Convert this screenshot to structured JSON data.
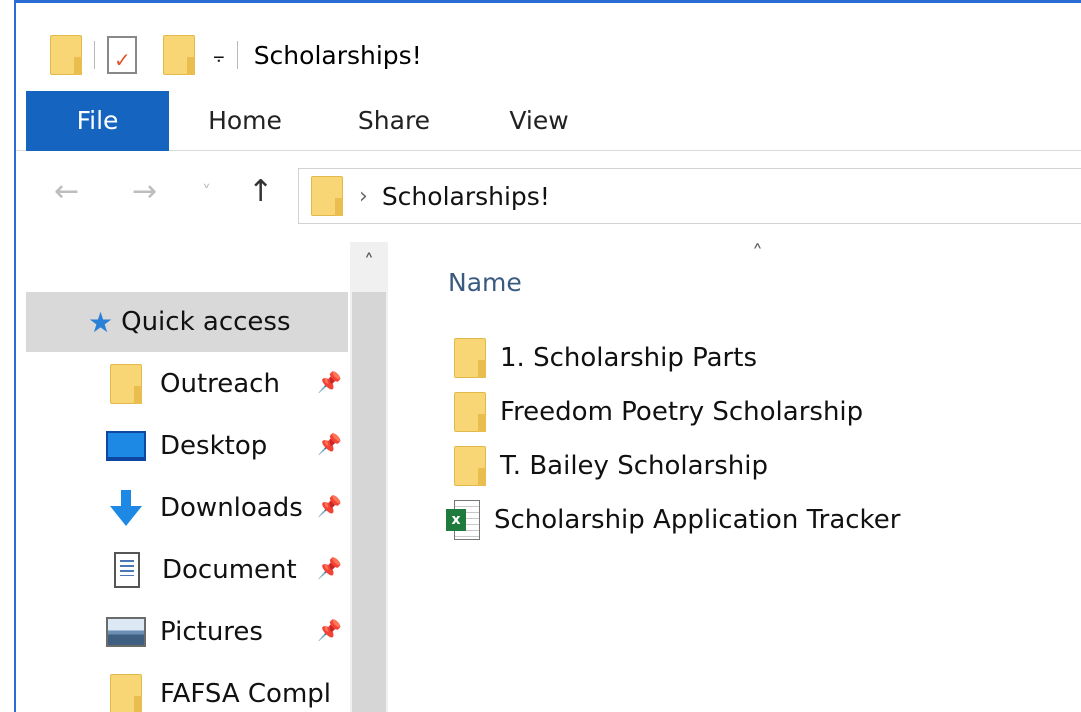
{
  "window": {
    "title": "Scholarships!",
    "qat_dropdown_glyph": "⨪"
  },
  "ribbon": {
    "tabs": [
      {
        "label": "File",
        "active": true
      },
      {
        "label": "Home"
      },
      {
        "label": "Share"
      },
      {
        "label": "View"
      }
    ]
  },
  "navigation": {
    "back_glyph": "←",
    "forward_glyph": "→",
    "recent_glyph": "˅",
    "up_glyph": "↑",
    "address_chevron": "›",
    "address_path": "Scholarships!"
  },
  "navpane": {
    "scroll_up_glyph": "˄",
    "items": [
      {
        "label": "Quick access",
        "icon": "quick-access-star-icon",
        "selected": true
      },
      {
        "label": "Outreach",
        "icon": "folder-icon",
        "pinned": true
      },
      {
        "label": "Desktop",
        "icon": "desktop-icon",
        "pinned": true
      },
      {
        "label": "Downloads",
        "icon": "downloads-icon",
        "pinned": true
      },
      {
        "label": "Document",
        "icon": "documents-icon",
        "pinned": true
      },
      {
        "label": "Pictures",
        "icon": "pictures-icon",
        "pinned": true
      },
      {
        "label": "FAFSA Compl",
        "icon": "folder-icon",
        "pinned": false
      }
    ],
    "pin_glyph": "📌"
  },
  "content": {
    "sort_indicator": "˄",
    "column_name": "Name",
    "files": [
      {
        "name": "1. Scholarship Parts",
        "type": "folder"
      },
      {
        "name": "Freedom Poetry Scholarship",
        "type": "folder"
      },
      {
        "name": "T. Bailey Scholarship",
        "type": "folder"
      },
      {
        "name": "Scholarship Application Tracker",
        "type": "excel"
      }
    ]
  },
  "colors": {
    "accent": "#1565c0",
    "window_border": "#2b6cd4",
    "folder": "#f9d675",
    "excel": "#1f7a3e",
    "selection": "#d9d9d9"
  }
}
